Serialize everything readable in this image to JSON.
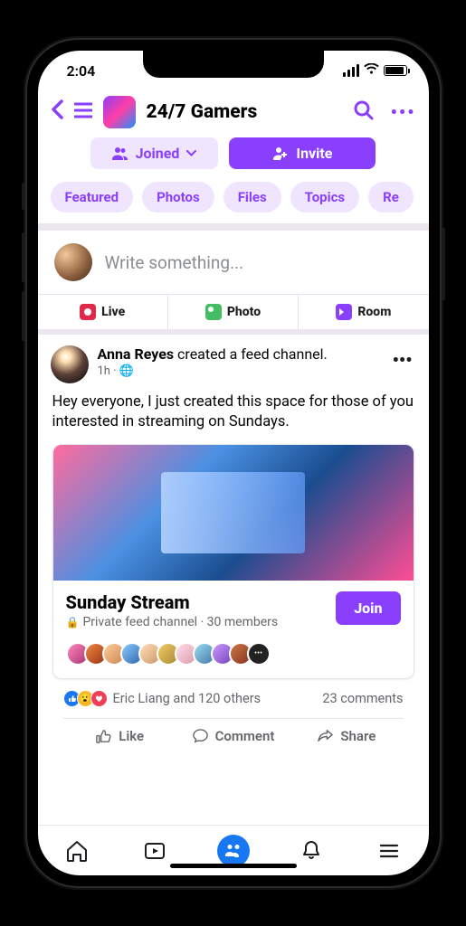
{
  "status": {
    "time": "2:04"
  },
  "header": {
    "group_name": "24/7 Gamers"
  },
  "actions": {
    "joined": "Joined",
    "invite": "Invite"
  },
  "tabs": [
    "Featured",
    "Photos",
    "Files",
    "Topics",
    "Re"
  ],
  "composer": {
    "placeholder": "Write something...",
    "live": "Live",
    "photo": "Photo",
    "room": "Room"
  },
  "post": {
    "author": "Anna Reyes",
    "action_text": " created a feed channel.",
    "time": "1h",
    "privacy": "Public",
    "body": "Hey everyone, I just created this space for those of you interested in streaming on Sundays.",
    "channel": {
      "title": "Sunday Stream",
      "subtitle": "Private feed channel · 30 members",
      "join": "Join"
    },
    "reactions_text": "Eric Liang and 120 others",
    "comments": "23 comments",
    "like": "Like",
    "comment": "Comment",
    "share": "Share"
  }
}
